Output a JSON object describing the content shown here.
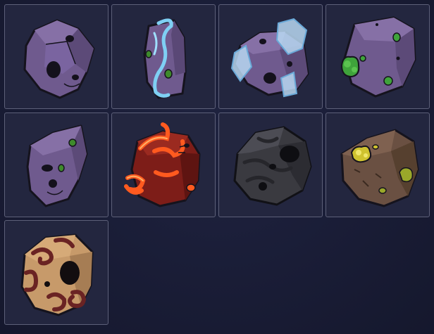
{
  "palette": {
    "background": "#181b33",
    "tile_fill": "#23263f",
    "tile_border": "#5d6079",
    "outline": "#15131d"
  },
  "asteroids": [
    {
      "id": "purple-rock",
      "icon": "purple-asteroid-icon"
    },
    {
      "id": "purple-ice-streak",
      "icon": "purple-asteroid-ice-streak-icon"
    },
    {
      "id": "purple-ice-crystal",
      "icon": "purple-asteroid-ice-crystal-icon"
    },
    {
      "id": "purple-green-ore",
      "icon": "purple-asteroid-green-ore-icon"
    },
    {
      "id": "purple-small-ore",
      "icon": "purple-asteroid-small-ore-icon"
    },
    {
      "id": "molten-red",
      "icon": "molten-lava-asteroid-icon"
    },
    {
      "id": "black-coal",
      "icon": "black-coal-asteroid-icon"
    },
    {
      "id": "brown-gold-ore",
      "icon": "brown-asteroid-gold-ore-icon"
    },
    {
      "id": "tan-swirl",
      "icon": "tan-swirl-asteroid-icon"
    }
  ]
}
